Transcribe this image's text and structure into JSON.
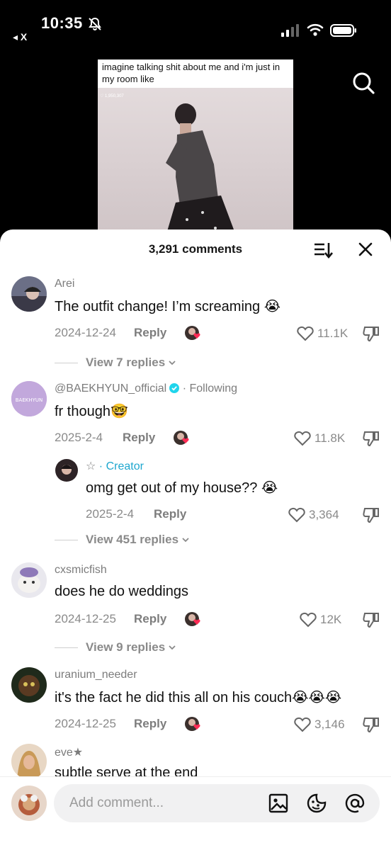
{
  "status": {
    "time": "10:35",
    "back_app": "◂ X"
  },
  "video": {
    "caption": "imagine talking shit about me and i'm just in my room like",
    "views": "♡ 1,950,307"
  },
  "sheet": {
    "comments_count": "3,291 comments"
  },
  "comments": [
    {
      "user": "Arei",
      "text": "The outfit change! I’m screaming 😭",
      "date": "2024-12-24",
      "reply": "Reply",
      "likes": "11.1K",
      "view_replies": "View 7 replies"
    },
    {
      "user": "@BAEKHYUN_official",
      "following": "· Following",
      "text": "fr though🤓",
      "date": "2025-2-4",
      "reply": "Reply",
      "likes": "11.8K",
      "avatar_text": "BAEKHYUN"
    },
    {
      "user": "☆",
      "creator": "· Creator",
      "text": "omg get out of my house?? 😭",
      "date": "2025-2-4",
      "reply": "Reply",
      "likes": "3,364",
      "view_replies": "View 451 replies"
    },
    {
      "user": "cxsmicfish",
      "text": "does he do weddings",
      "date": "2024-12-25",
      "reply": "Reply",
      "likes": "12K",
      "view_replies": "View 9 replies"
    },
    {
      "user": "uranium_needer",
      "text": "it's the fact he did this all on his couch😭😭😭",
      "date": "2024-12-25",
      "reply": "Reply",
      "likes": "3,146"
    },
    {
      "user": "eve★",
      "text": "subtle serve at the end"
    }
  ],
  "composer": {
    "placeholder": "Add comment..."
  },
  "colors": {
    "accent_heart": "#fe2c55",
    "creator": "#1ea7cf",
    "verified": "#20d5ec"
  }
}
